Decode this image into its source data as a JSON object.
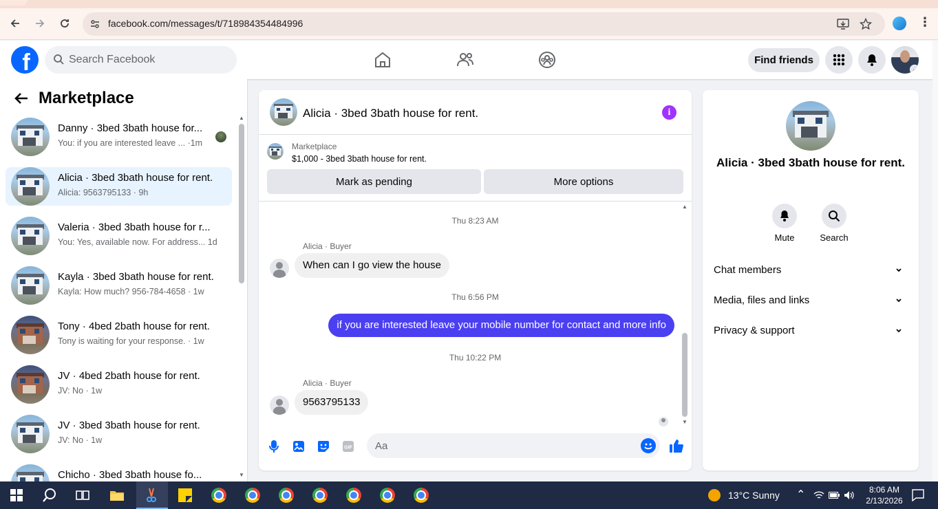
{
  "browser": {
    "url": "facebook.com/messages/t/718984354484996"
  },
  "header": {
    "search_placeholder": "Search Facebook",
    "find_friends": "Find friends",
    "logo": "f"
  },
  "sidebar": {
    "title": "Marketplace",
    "conversations": [
      {
        "name": "Danny · 3bed 3bath house for...",
        "preview": "You: if you are interested leave ... ·1m",
        "thumb": "house-white"
      },
      {
        "name": "Alicia · 3bed 3bath house for rent.",
        "preview": "Alicia: 9563795133 · 9h",
        "thumb": "house-white",
        "active": true
      },
      {
        "name": "Valeria · 3bed 3bath house for r...",
        "preview": "You: Yes, available now. For address... 1d",
        "thumb": "house-white"
      },
      {
        "name": "Kayla · 3bed 3bath house for rent.",
        "preview": "Kayla: How much? 956-784-4658 · 1w",
        "thumb": "house-white"
      },
      {
        "name": "Tony · 4bed 2bath house for rent.",
        "preview": "Tony is waiting for your response. · 1w",
        "thumb": "house-brick"
      },
      {
        "name": "JV · 4bed 2bath house for rent.",
        "preview": "JV: No · 1w",
        "thumb": "house-brick"
      },
      {
        "name": "JV · 3bed 3bath house for rent.",
        "preview": "JV: No · 1w",
        "thumb": "house-white"
      },
      {
        "name": "Chicho · 3bed 3bath house fo...",
        "preview": "",
        "thumb": "house-white"
      }
    ]
  },
  "chat": {
    "title": "Alicia · 3bed 3bath house for rent.",
    "listing_label": "Marketplace",
    "listing_price": "$1,000 - 3bed 3bath house for rent.",
    "mark_pending": "Mark as pending",
    "more_options": "More options",
    "messages": [
      {
        "timestamp": "Thu 8:23 AM"
      },
      {
        "sender": "Alicia · Buyer",
        "text": "When can I go view the house",
        "direction": "in"
      },
      {
        "timestamp": "Thu 6:56 PM"
      },
      {
        "text": "if you are interested leave your mobile number for contact and more info",
        "direction": "out"
      },
      {
        "timestamp": "Thu 10:22 PM"
      },
      {
        "sender": "Alicia · Buyer",
        "text": "9563795133",
        "direction": "in"
      }
    ],
    "composer_placeholder": "Aa",
    "gif_label": "GIF"
  },
  "details": {
    "title": "Alicia · 3bed 3bath house for rent.",
    "mute": "Mute",
    "search": "Search",
    "sections": [
      "Chat members",
      "Media, files and links",
      "Privacy & support"
    ]
  },
  "taskbar": {
    "weather": "13°C  Sunny",
    "time": "8:06 AM",
    "date": "2/13/2026"
  },
  "colors": {
    "fb_blue": "#0866ff",
    "outgoing_bubble": "#4b3ff2",
    "active_conv": "#e7f3ff",
    "info_purple": "#a033ff"
  }
}
